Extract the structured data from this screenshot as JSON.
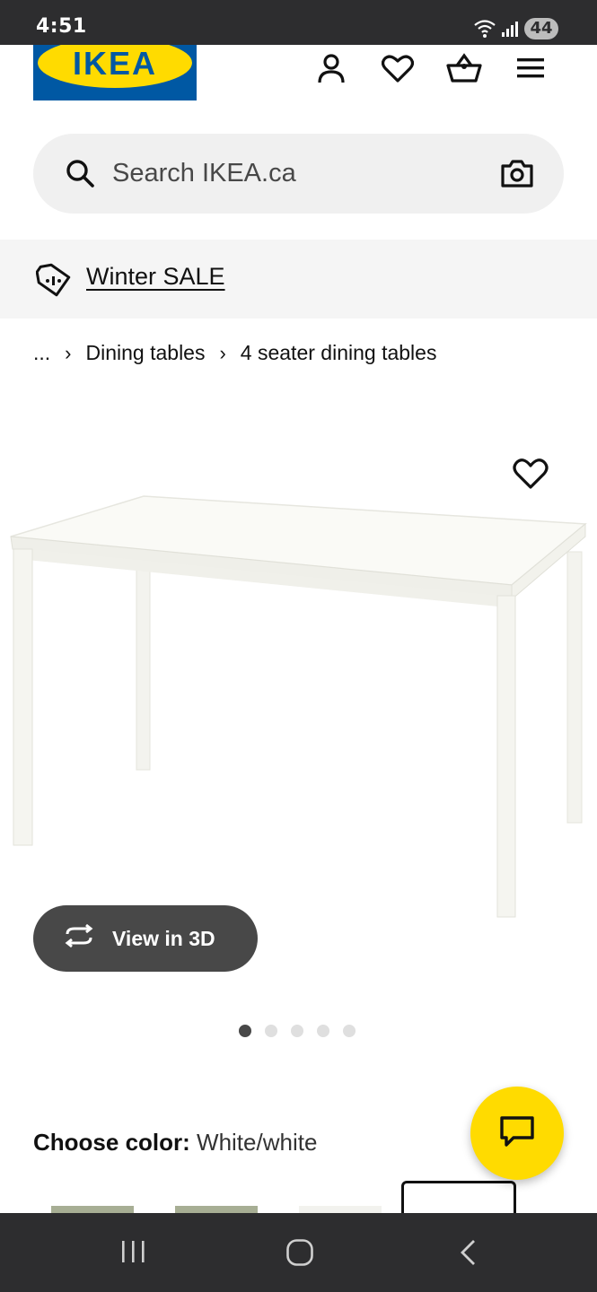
{
  "status_bar": {
    "time": "4:51",
    "battery": "44"
  },
  "header": {
    "logo_text": "IKEA"
  },
  "search": {
    "placeholder": "Search IKEA.ca"
  },
  "promo": {
    "label": "Winter SALE"
  },
  "breadcrumb": {
    "ellipsis": "...",
    "items": [
      "Dining tables",
      "4 seater dining tables"
    ]
  },
  "product": {
    "view3d_label": "View in 3D",
    "image_count": 5,
    "active_image": 0
  },
  "color": {
    "label": "Choose color:",
    "value": "White/white"
  },
  "colors": {
    "brand_blue": "#0058a3",
    "brand_yellow": "#ffdb00",
    "dark": "#484848"
  }
}
